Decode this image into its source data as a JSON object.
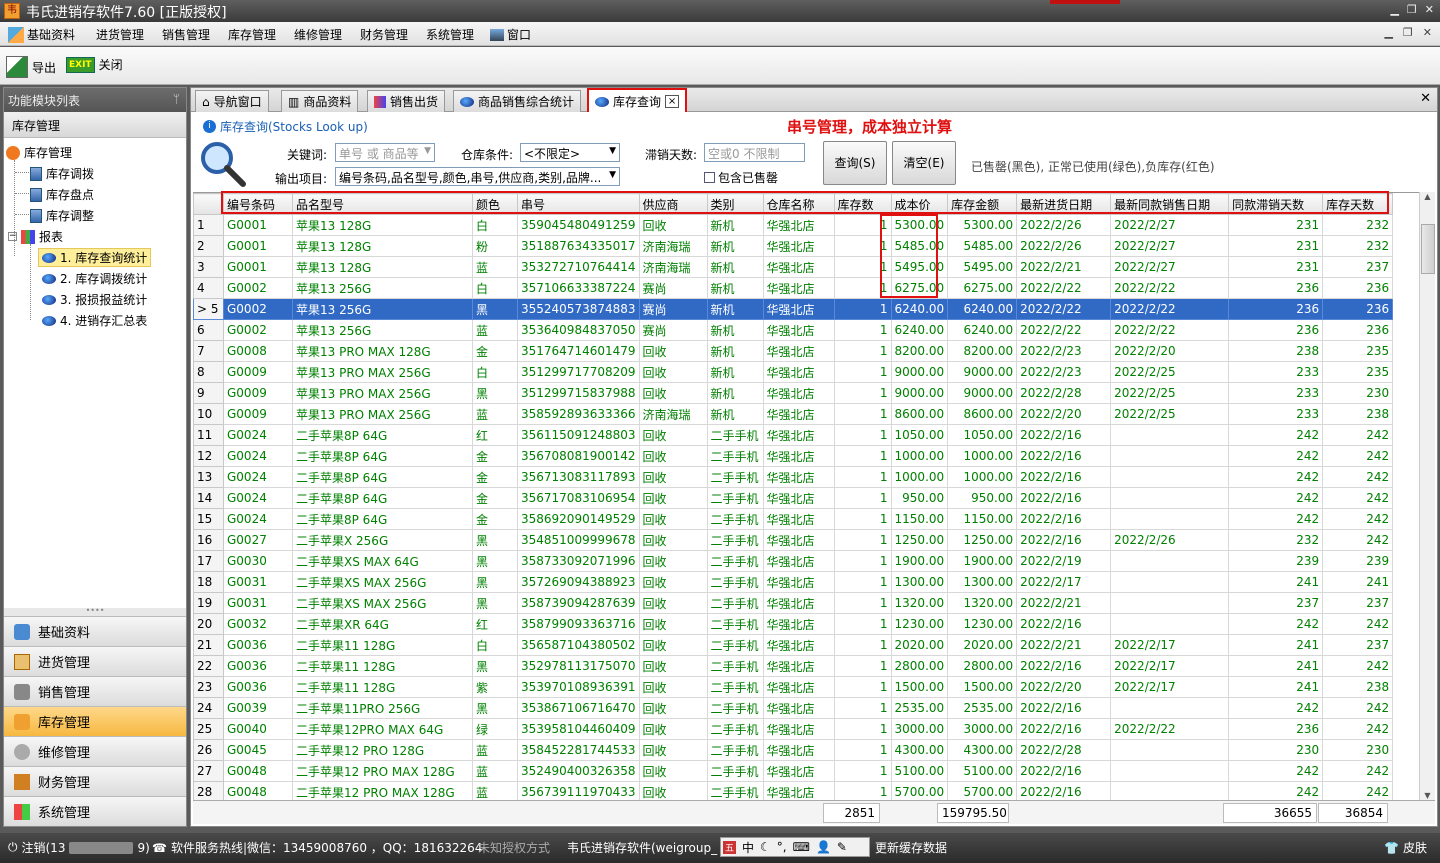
{
  "app": {
    "title": "韦氏进销存软件7.60 [正版授权]"
  },
  "menu": [
    "基础资料",
    "进货管理",
    "销售管理",
    "库存管理",
    "维修管理",
    "财务管理",
    "系统管理",
    "窗口"
  ],
  "toolbar": {
    "export": "导出",
    "close": "关闭",
    "exit_badge": "EXIT"
  },
  "left_panel": {
    "title": "功能模块列表",
    "pin": "ᛘ",
    "section": "库存管理",
    "tree": {
      "root": "库存管理",
      "items": [
        "库存调拨",
        "库存盘点",
        "库存调整"
      ],
      "reports": "报表",
      "report_items": [
        "1. 库存查询统计",
        "2. 库存调拨统计",
        "3. 报损报益统计",
        "4. 进销存汇总表"
      ]
    },
    "nav": [
      "基础资料",
      "进货管理",
      "销售管理",
      "库存管理",
      "维修管理",
      "财务管理",
      "系统管理"
    ],
    "active_nav": "库存管理"
  },
  "tabs": [
    {
      "label": "导航窗口"
    },
    {
      "label": "商品资料"
    },
    {
      "label": "销售出货"
    },
    {
      "label": "商品销售综合统计"
    },
    {
      "label": "库存查询",
      "active": true
    }
  ],
  "tab_close": "×",
  "search": {
    "heading": "库存查询(Stocks Look up)",
    "annotation": "串号管理，成本独立计算",
    "keyword_label": "关键词:",
    "keyword_placeholder": "单号 或 商品等",
    "warehouse_label": "仓库条件:",
    "warehouse_value": "<不限定>",
    "slow_label": "滞销天数:",
    "slow_placeholder": "空或0 不限制",
    "output_label": "输出项目:",
    "output_value": "编号条码,品名型号,颜色,串号,供应商,类别,品牌...",
    "include_sold": "包含已售罄",
    "include_sold_checked": false,
    "query_btn": "查询(S)",
    "clear_btn": "清空(E)",
    "legend": "已售罄(黑色), 正常已使用(绿色),负库存(红色)"
  },
  "columns": [
    "编号条码",
    "品名型号",
    "颜色",
    "串号",
    "供应商",
    "类别",
    "仓库名称",
    "库存数",
    "成本价",
    "库存金额",
    "最新进货日期",
    "最新同款销售日期",
    "同款滞销天数",
    "库存天数"
  ],
  "rows": [
    [
      "1",
      "G0001",
      "苹果13 128G",
      "白",
      "359045480491259",
      "回收",
      "新机",
      "华强北店",
      "1",
      "5300.00",
      "5300.00",
      "2022/2/26",
      "2022/2/27",
      "231",
      "232"
    ],
    [
      "2",
      "G0001",
      "苹果13 128G",
      "粉",
      "351887634335017",
      "济南海瑞",
      "新机",
      "华强北店",
      "1",
      "5485.00",
      "5485.00",
      "2022/2/26",
      "2022/2/27",
      "231",
      "232"
    ],
    [
      "3",
      "G0001",
      "苹果13 128G",
      "蓝",
      "353272710764414",
      "济南海瑞",
      "新机",
      "华强北店",
      "1",
      "5495.00",
      "5495.00",
      "2022/2/21",
      "2022/2/27",
      "231",
      "237"
    ],
    [
      "4",
      "G0002",
      "苹果13 256G",
      "白",
      "357106633387224",
      "赛尚",
      "新机",
      "华强北店",
      "1",
      "6275.00",
      "6275.00",
      "2022/2/22",
      "2022/2/22",
      "236",
      "236"
    ],
    [
      "5",
      "G0002",
      "苹果13 256G",
      "黑",
      "355240573874883",
      "赛尚",
      "新机",
      "华强北店",
      "1",
      "6240.00",
      "6240.00",
      "2022/2/22",
      "2022/2/22",
      "236",
      "236"
    ],
    [
      "6",
      "G0002",
      "苹果13 256G",
      "蓝",
      "353640984837050",
      "赛尚",
      "新机",
      "华强北店",
      "1",
      "6240.00",
      "6240.00",
      "2022/2/22",
      "2022/2/22",
      "236",
      "236"
    ],
    [
      "7",
      "G0008",
      "苹果13 PRO MAX 128G",
      "金",
      "351764714601479",
      "回收",
      "新机",
      "华强北店",
      "1",
      "8200.00",
      "8200.00",
      "2022/2/23",
      "2022/2/20",
      "238",
      "235"
    ],
    [
      "8",
      "G0009",
      "苹果13 PRO MAX 256G",
      "白",
      "351299717708209",
      "回收",
      "新机",
      "华强北店",
      "1",
      "9000.00",
      "9000.00",
      "2022/2/23",
      "2022/2/25",
      "233",
      "235"
    ],
    [
      "9",
      "G0009",
      "苹果13 PRO MAX 256G",
      "黑",
      "351299715837988",
      "回收",
      "新机",
      "华强北店",
      "1",
      "9000.00",
      "9000.00",
      "2022/2/28",
      "2022/2/25",
      "233",
      "230"
    ],
    [
      "10",
      "G0009",
      "苹果13 PRO MAX 256G",
      "蓝",
      "358592893633366",
      "济南海瑞",
      "新机",
      "华强北店",
      "1",
      "8600.00",
      "8600.00",
      "2022/2/20",
      "2022/2/25",
      "233",
      "238"
    ],
    [
      "11",
      "G0024",
      "二手苹果8P 64G",
      "红",
      "356115091248803",
      "回收",
      "二手手机",
      "华强北店",
      "1",
      "1050.00",
      "1050.00",
      "2022/2/16",
      "",
      "242",
      "242"
    ],
    [
      "12",
      "G0024",
      "二手苹果8P 64G",
      "金",
      "356708081900142",
      "回收",
      "二手手机",
      "华强北店",
      "1",
      "1000.00",
      "1000.00",
      "2022/2/16",
      "",
      "242",
      "242"
    ],
    [
      "13",
      "G0024",
      "二手苹果8P 64G",
      "金",
      "356713083117893",
      "回收",
      "二手手机",
      "华强北店",
      "1",
      "1000.00",
      "1000.00",
      "2022/2/16",
      "",
      "242",
      "242"
    ],
    [
      "14",
      "G0024",
      "二手苹果8P 64G",
      "金",
      "356717083106954",
      "回收",
      "二手手机",
      "华强北店",
      "1",
      "950.00",
      "950.00",
      "2022/2/16",
      "",
      "242",
      "242"
    ],
    [
      "15",
      "G0024",
      "二手苹果8P 64G",
      "金",
      "358692090149529",
      "回收",
      "二手手机",
      "华强北店",
      "1",
      "1150.00",
      "1150.00",
      "2022/2/16",
      "",
      "242",
      "242"
    ],
    [
      "16",
      "G0027",
      "二手苹果X 256G",
      "黑",
      "354851009999678",
      "回收",
      "二手手机",
      "华强北店",
      "1",
      "1250.00",
      "1250.00",
      "2022/2/16",
      "2022/2/26",
      "232",
      "242"
    ],
    [
      "17",
      "G0030",
      "二手苹果XS MAX  64G",
      "黑",
      "358733092071996",
      "回收",
      "二手手机",
      "华强北店",
      "1",
      "1900.00",
      "1900.00",
      "2022/2/19",
      "",
      "239",
      "239"
    ],
    [
      "18",
      "G0031",
      "二手苹果XS MAX  256G",
      "黑",
      "357269094388923",
      "回收",
      "二手手机",
      "华强北店",
      "1",
      "1300.00",
      "1300.00",
      "2022/2/17",
      "",
      "241",
      "241"
    ],
    [
      "19",
      "G0031",
      "二手苹果XS MAX  256G",
      "黑",
      "358739094287639",
      "回收",
      "二手手机",
      "华强北店",
      "1",
      "1320.00",
      "1320.00",
      "2022/2/21",
      "",
      "237",
      "237"
    ],
    [
      "20",
      "G0032",
      "二手苹果XR 64G",
      "红",
      "358799093363716",
      "回收",
      "二手手机",
      "华强北店",
      "1",
      "1230.00",
      "1230.00",
      "2022/2/16",
      "",
      "242",
      "242"
    ],
    [
      "21",
      "G0036",
      "二手苹果11 128G",
      "白",
      "356587104380502",
      "回收",
      "二手手机",
      "华强北店",
      "1",
      "2020.00",
      "2020.00",
      "2022/2/21",
      "2022/2/17",
      "241",
      "237"
    ],
    [
      "22",
      "G0036",
      "二手苹果11 128G",
      "黑",
      "352978113175070",
      "回收",
      "二手手机",
      "华强北店",
      "1",
      "2800.00",
      "2800.00",
      "2022/2/16",
      "2022/2/17",
      "241",
      "242"
    ],
    [
      "23",
      "G0036",
      "二手苹果11 128G",
      "紫",
      "353970108936391",
      "回收",
      "二手手机",
      "华强北店",
      "1",
      "1500.00",
      "1500.00",
      "2022/2/20",
      "2022/2/17",
      "241",
      "238"
    ],
    [
      "24",
      "G0039",
      "二手苹果11PRO  256G",
      "黑",
      "353867106716470",
      "回收",
      "二手手机",
      "华强北店",
      "1",
      "2535.00",
      "2535.00",
      "2022/2/16",
      "",
      "242",
      "242"
    ],
    [
      "25",
      "G0040",
      "二手苹果12PRO MAX 64G",
      "绿",
      "353958104460409",
      "回收",
      "二手手机",
      "华强北店",
      "1",
      "3000.00",
      "3000.00",
      "2022/2/16",
      "2022/2/22",
      "236",
      "242"
    ],
    [
      "26",
      "G0045",
      "二手苹果12 PRO  128G",
      "蓝",
      "358452281744533",
      "回收",
      "二手手机",
      "华强北店",
      "1",
      "4300.00",
      "4300.00",
      "2022/2/28",
      "",
      "230",
      "230"
    ],
    [
      "27",
      "G0048",
      "二手苹果12 PRO MAX  128G",
      "蓝",
      "352490400326358",
      "回收",
      "二手手机",
      "华强北店",
      "1",
      "5100.00",
      "5100.00",
      "2022/2/16",
      "",
      "242",
      "242"
    ],
    [
      "28",
      "G0048",
      "二手苹果12 PRO MAX  128G",
      "蓝",
      "356739111970433",
      "回收",
      "二手手机",
      "华强北店",
      "1",
      "5700.00",
      "5700.00",
      "2022/2/16",
      "",
      "242",
      "242"
    ]
  ],
  "selected_row_marker": "> 5",
  "totals": {
    "stock_qty": "2851",
    "stock_amount": "159795.50",
    "slow_days": "36655",
    "stock_days": "36854"
  },
  "status": {
    "logout": "注销(13",
    "logout_tail": "9)",
    "hotline": "软件服务热线|微信：13459008760  ，QQ：181632264",
    "license": "未知授权方式",
    "product": "韦氏进销存软件(weigroup_",
    "ime": "中",
    "cache": "更新缓存数据",
    "skin": "皮肤"
  }
}
